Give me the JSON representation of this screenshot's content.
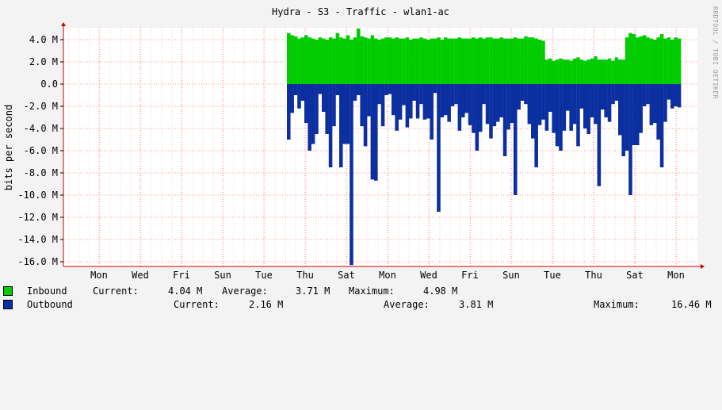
{
  "chart_data": {
    "type": "area",
    "title": "Hydra - S3 - Traffic - wlan1-ac",
    "ylabel": "bits per second",
    "side_text": "RRDTOOL / TOBI OETIKER",
    "ylim": [
      -16.3,
      5.0
    ],
    "y_ticks": [
      4.0,
      2.0,
      0.0,
      -2.0,
      -4.0,
      -6.0,
      -8.0,
      -10.0,
      -12.0,
      -14.0,
      -16.0
    ],
    "y_tick_labels": [
      "4.0 M",
      "2.0 M",
      "0.0",
      "-2.0 M",
      "-4.0 M",
      "-6.0 M",
      "-8.0 M",
      "-10.0 M",
      "-12.0 M",
      "-14.0 M",
      "-16.0 M"
    ],
    "x_tick_labels": [
      "Mon",
      "Wed",
      "Fri",
      "Sun",
      "Tue",
      "Thu",
      "Sat",
      "Mon",
      "Wed",
      "Fri",
      "Sun",
      "Tue",
      "Thu",
      "Sat",
      "Mon"
    ],
    "grid": true,
    "colors": {
      "inbound": "#00cc00",
      "outbound": "#0b2fa0",
      "grid_minor": "#ffcccc",
      "grid_major": "#ff9999",
      "axis": "#cc0000"
    },
    "series": [
      {
        "name": "Inbound",
        "values": [
          4.6,
          4.4,
          4.3,
          4.1,
          4.2,
          4.4,
          4.2,
          4.1,
          4.0,
          4.2,
          4.1,
          4.0,
          4.2,
          4.1,
          4.6,
          4.2,
          4.1,
          4.4,
          4.0,
          4.2,
          5.0,
          4.3,
          4.2,
          4.1,
          4.4,
          4.1,
          4.0,
          4.1,
          4.2,
          4.2,
          4.1,
          4.2,
          4.1,
          4.1,
          4.2,
          4.0,
          4.1,
          4.1,
          4.2,
          4.1,
          4.0,
          4.1,
          4.1,
          4.2,
          4.0,
          4.2,
          4.1,
          4.1,
          4.1,
          4.2,
          4.1,
          4.1,
          4.1,
          4.2,
          4.1,
          4.2,
          4.1,
          4.2,
          4.2,
          4.1,
          4.1,
          4.2,
          4.1,
          4.1,
          4.1,
          4.2,
          4.1,
          4.1,
          4.3,
          4.2,
          4.2,
          4.1,
          4.0,
          3.9,
          2.2,
          2.3,
          2.1,
          2.2,
          2.3,
          2.2,
          2.2,
          2.1,
          2.3,
          2.4,
          2.2,
          2.1,
          2.2,
          2.3,
          2.5,
          2.2,
          2.2,
          2.2,
          2.3,
          2.1,
          2.4,
          2.2,
          2.2,
          4.2,
          4.6,
          4.5,
          4.2,
          4.3,
          4.4,
          4.2,
          4.1,
          4.0,
          4.2,
          4.5,
          4.1,
          4.2,
          4.0,
          4.2,
          4.1
        ],
        "_note": "Mbit/s, one value per column"
      },
      {
        "name": "Outbound",
        "values": [
          -5.0,
          -2.6,
          -1.0,
          -2.2,
          -1.5,
          -3.5,
          -6.0,
          -5.4,
          -4.5,
          -0.9,
          -2.5,
          -4.5,
          -7.5,
          -3.8,
          -1.0,
          -7.5,
          -5.4,
          -5.4,
          -16.3,
          -1.5,
          -1.0,
          -3.8,
          -5.6,
          -2.9,
          -8.6,
          -8.7,
          -1.8,
          -3.8,
          -1.0,
          -0.9,
          -2.8,
          -4.2,
          -3.2,
          -1.9,
          -3.9,
          -3.1,
          -1.5,
          -3.1,
          -1.8,
          -3.2,
          -3.1,
          -5.0,
          -0.8,
          -11.5,
          -3.0,
          -2.8,
          -3.4,
          -2.0,
          -1.8,
          -4.2,
          -3.0,
          -2.6,
          -3.7,
          -4.4,
          -6.0,
          -4.3,
          -1.8,
          -3.6,
          -4.9,
          -3.8,
          -3.4,
          -3.0,
          -6.5,
          -4.1,
          -3.5,
          -10.0,
          -2.3,
          -1.5,
          -1.8,
          -3.6,
          -4.9,
          -7.5,
          -3.7,
          -3.2,
          -4.2,
          -2.5,
          -4.4,
          -5.6,
          -6.0,
          -4.2,
          -2.4,
          -4.2,
          -3.6,
          -5.6,
          -2.2,
          -4.0,
          -4.5,
          -3.0,
          -3.6,
          -9.2,
          -2.3,
          -3.0,
          -3.4,
          -1.8,
          -1.5,
          -4.6,
          -6.5,
          -6.0,
          -10.0,
          -5.5,
          -5.5,
          -4.4,
          -2.0,
          -1.8,
          -3.7,
          -3.5,
          -5.0,
          -7.5,
          -3.4,
          -1.4,
          -2.2,
          -2.0,
          -2.1
        ]
      }
    ]
  },
  "legend": {
    "inbound": {
      "name": "Inbound",
      "current_label": "Current:",
      "current": "4.04 M",
      "average_label": "Average:",
      "average": "3.71 M",
      "maximum_label": "Maximum:",
      "maximum": "4.98 M"
    },
    "outbound": {
      "name": "Outbound",
      "current_label": "Current:",
      "current": "2.16 M",
      "average_label": "Average:",
      "average": "3.81 M",
      "maximum_label": "Maximum:",
      "maximum": "16.46 M"
    }
  }
}
